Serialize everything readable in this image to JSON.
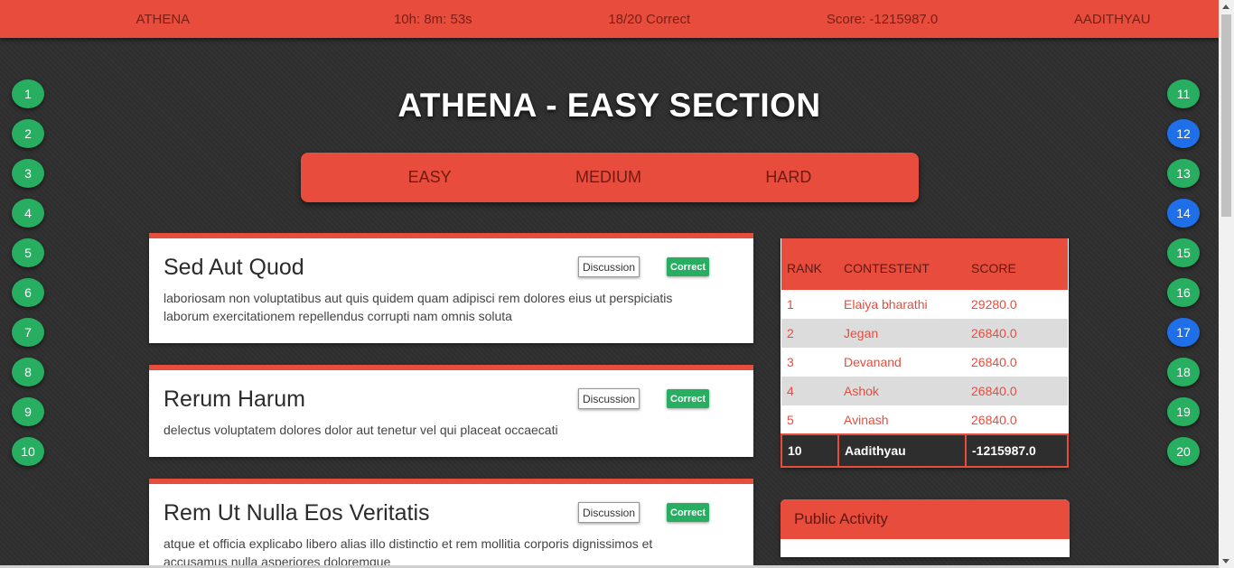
{
  "topbar": {
    "app": "ATHENA",
    "timer": "10h: 8m: 53s",
    "progress": "18/20 Correct",
    "score": "Score: -1215987.0",
    "user": "AADITHYAU"
  },
  "page_title": "ATHENA - EASY SECTION",
  "tabs": [
    "EASY",
    "MEDIUM",
    "HARD"
  ],
  "question_nav": {
    "left": [
      {
        "n": "1",
        "status": "green"
      },
      {
        "n": "2",
        "status": "green"
      },
      {
        "n": "3",
        "status": "green"
      },
      {
        "n": "4",
        "status": "green"
      },
      {
        "n": "5",
        "status": "green"
      },
      {
        "n": "6",
        "status": "green"
      },
      {
        "n": "7",
        "status": "green"
      },
      {
        "n": "8",
        "status": "green"
      },
      {
        "n": "9",
        "status": "green"
      },
      {
        "n": "10",
        "status": "green"
      }
    ],
    "right": [
      {
        "n": "11",
        "status": "green"
      },
      {
        "n": "12",
        "status": "blue"
      },
      {
        "n": "13",
        "status": "green"
      },
      {
        "n": "14",
        "status": "blue"
      },
      {
        "n": "15",
        "status": "green"
      },
      {
        "n": "16",
        "status": "green"
      },
      {
        "n": "17",
        "status": "blue"
      },
      {
        "n": "18",
        "status": "green"
      },
      {
        "n": "19",
        "status": "green"
      },
      {
        "n": "20",
        "status": "green"
      }
    ]
  },
  "problems": [
    {
      "title": "Sed Aut Quod",
      "description": "laboriosam non voluptatibus aut quis quidem quam adipisci rem dolores eius ut perspiciatis laborum exercitationem repellendus corrupti nam omnis soluta",
      "discussion_label": "Discussion",
      "status": "Correct"
    },
    {
      "title": "Rerum Harum",
      "description": "delectus voluptatem dolores dolor aut tenetur vel qui placeat occaecati",
      "discussion_label": "Discussion",
      "status": "Correct"
    },
    {
      "title": "Rem Ut Nulla Eos Veritatis",
      "description": "atque et officia explicabo libero alias illo distinctio et rem mollitia corporis dignissimos et accusamus nulla asperiores doloremque",
      "discussion_label": "Discussion",
      "status": "Correct"
    }
  ],
  "leaderboard": {
    "headers": [
      "RANK",
      "CONTESTENT",
      "SCORE"
    ],
    "rows": [
      {
        "rank": "1",
        "name": "Elaiya bharathi",
        "score": "29280.0"
      },
      {
        "rank": "2",
        "name": "Jegan",
        "score": "26840.0"
      },
      {
        "rank": "3",
        "name": "Devanand",
        "score": "26840.0"
      },
      {
        "rank": "4",
        "name": "Ashok",
        "score": "26840.0"
      },
      {
        "rank": "5",
        "name": "Avinash",
        "score": "26840.0"
      }
    ],
    "me": {
      "rank": "10",
      "name": "Aadithyau",
      "score": "-1215987.0"
    }
  },
  "public_activity": {
    "title": "Public Activity"
  },
  "colors": {
    "accent": "#e74c3c",
    "correct": "#27ae60",
    "attempted": "#1f6fe8",
    "background": "#2f2f2f"
  }
}
